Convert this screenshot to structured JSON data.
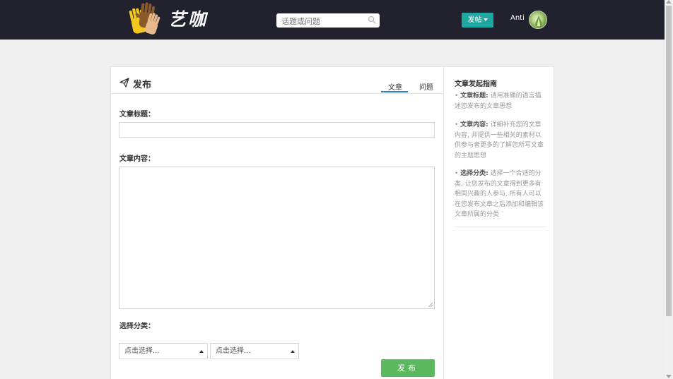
{
  "header": {
    "logo_text": "艺咖",
    "search_placeholder": "话题或问题",
    "post_button": "发帖",
    "username": "Anti",
    "bg_color": "#22222e",
    "accent_color": "#1fa8a2"
  },
  "card": {
    "title": "发布",
    "tabs": [
      {
        "label": "文章",
        "active": true
      },
      {
        "label": "问题",
        "active": false
      }
    ],
    "article_title_label": "文章标题：",
    "article_title_value": "",
    "article_content_label": "文章内容：",
    "article_content_value": "",
    "category_label": "选择分类：",
    "select_1": "点击选择...",
    "select_2": "点击选择...",
    "submit_label": "发布",
    "submit_color": "#5cb85c"
  },
  "guide": {
    "title": "文章发起指南",
    "items": [
      {
        "key": "文章标题:",
        "text": "请用准确的语言描述您发布的文章思想"
      },
      {
        "key": "文章内容:",
        "text": "详细补充您的文章内容, 并提供一些相关的素材以供参与者更多的了解您所写文章的主题思想"
      },
      {
        "key": "选择分类:",
        "text": "选择一个合适的分类, 让您发布的文章得到更多有相同兴趣的人参与. 所有人可以在您发布文章之后添加和编辑该文章所属的分类"
      }
    ]
  }
}
